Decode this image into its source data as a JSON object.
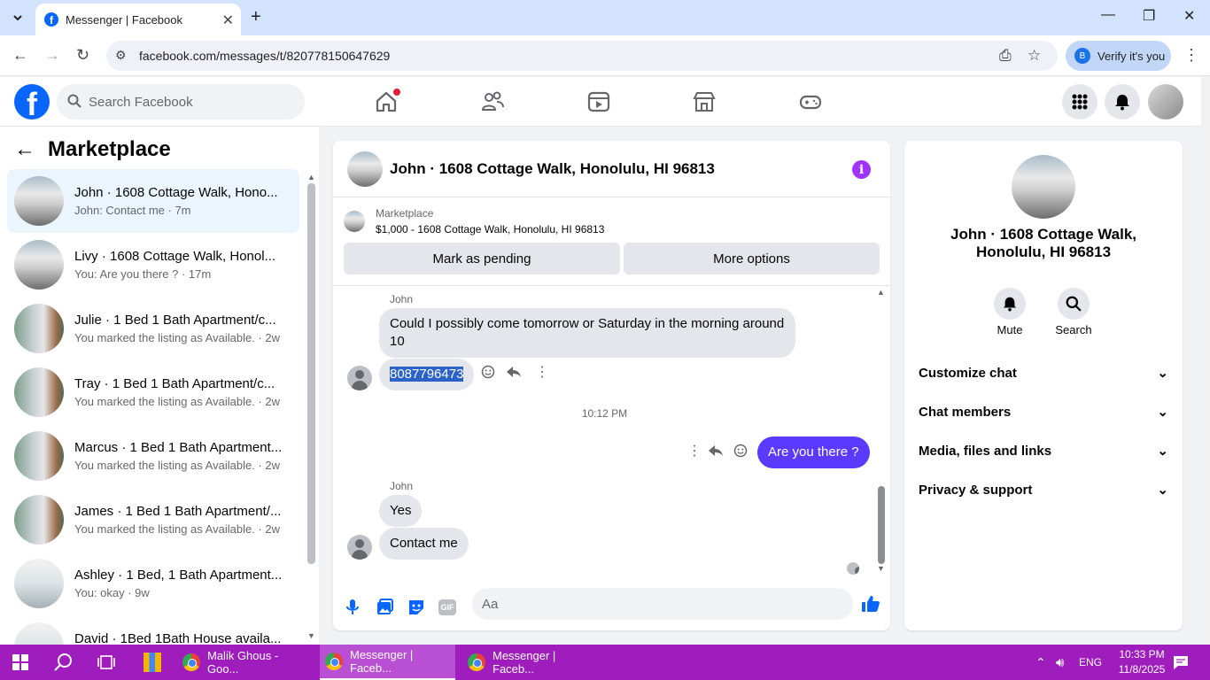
{
  "browser": {
    "tab_title": "Messenger | Facebook",
    "url": "facebook.com/messages/t/820778150647629",
    "verify_label": "Verify it's you",
    "verify_badge": "B"
  },
  "fb_header": {
    "logo_letter": "f",
    "search_placeholder": "Search Facebook"
  },
  "marketplace": {
    "title": "Marketplace",
    "conversations": [
      {
        "name": "John · 1608 Cottage Walk, Hono...",
        "sub": "John: Contact me · 7m"
      },
      {
        "name": "Livy · 1608 Cottage Walk, Honol...",
        "sub": "You: Are you there ? · 17m"
      },
      {
        "name": "Julie · 1 Bed 1 Bath Apartment/c...",
        "sub": "You marked the listing as Available. · 2w"
      },
      {
        "name": "Tray · 1 Bed 1 Bath Apartment/c...",
        "sub": "You marked the listing as Available. · 2w"
      },
      {
        "name": "Marcus · 1 Bed 1 Bath Apartment...",
        "sub": "You marked the listing as Available. · 2w"
      },
      {
        "name": "James · 1 Bed 1 Bath Apartment/...",
        "sub": "You marked the listing as Available. · 2w"
      },
      {
        "name": "Ashley · 1 Bed, 1 Bath Apartment...",
        "sub": "You: okay · 9w"
      },
      {
        "name": "David · 1Bed 1Bath House availa...",
        "sub": ""
      }
    ]
  },
  "chat": {
    "title": "John · 1608 Cottage Walk, Honolulu, HI 96813",
    "marketplace_label": "Marketplace",
    "listing": "$1,000 - 1608 Cottage Walk, Honolulu, HI 96813",
    "mark_pending": "Mark as pending",
    "more_options": "More options",
    "sender_1": "John",
    "msg_1": "Could I possibly come tomorrow or Saturday in the morning around 10",
    "msg_2": "8087796473",
    "timestamp": "10:12 PM",
    "msg_out": "Are you there ?",
    "sender_2": "John",
    "msg_3": "Yes",
    "msg_4": "Contact me",
    "composer_placeholder": "Aa",
    "gif_label": "GIF"
  },
  "details": {
    "name": "John · 1608 Cottage Walk, Honolulu, HI 96813",
    "mute_label": "Mute",
    "search_label": "Search",
    "items": [
      "Customize chat",
      "Chat members",
      "Media, files and links",
      "Privacy & support"
    ]
  },
  "taskbar": {
    "apps": [
      "Malik Ghous - Goo...",
      "Messenger | Faceb...",
      "Messenger | Faceb..."
    ],
    "language": "ENG",
    "time": "10:33 PM",
    "date": "11/8/2025"
  },
  "colors": {
    "fb_blue": "#0866ff",
    "outgoing_bubble": "#5b3aff",
    "taskbar": "#a01dbd",
    "info_icon": "#a033ff"
  }
}
